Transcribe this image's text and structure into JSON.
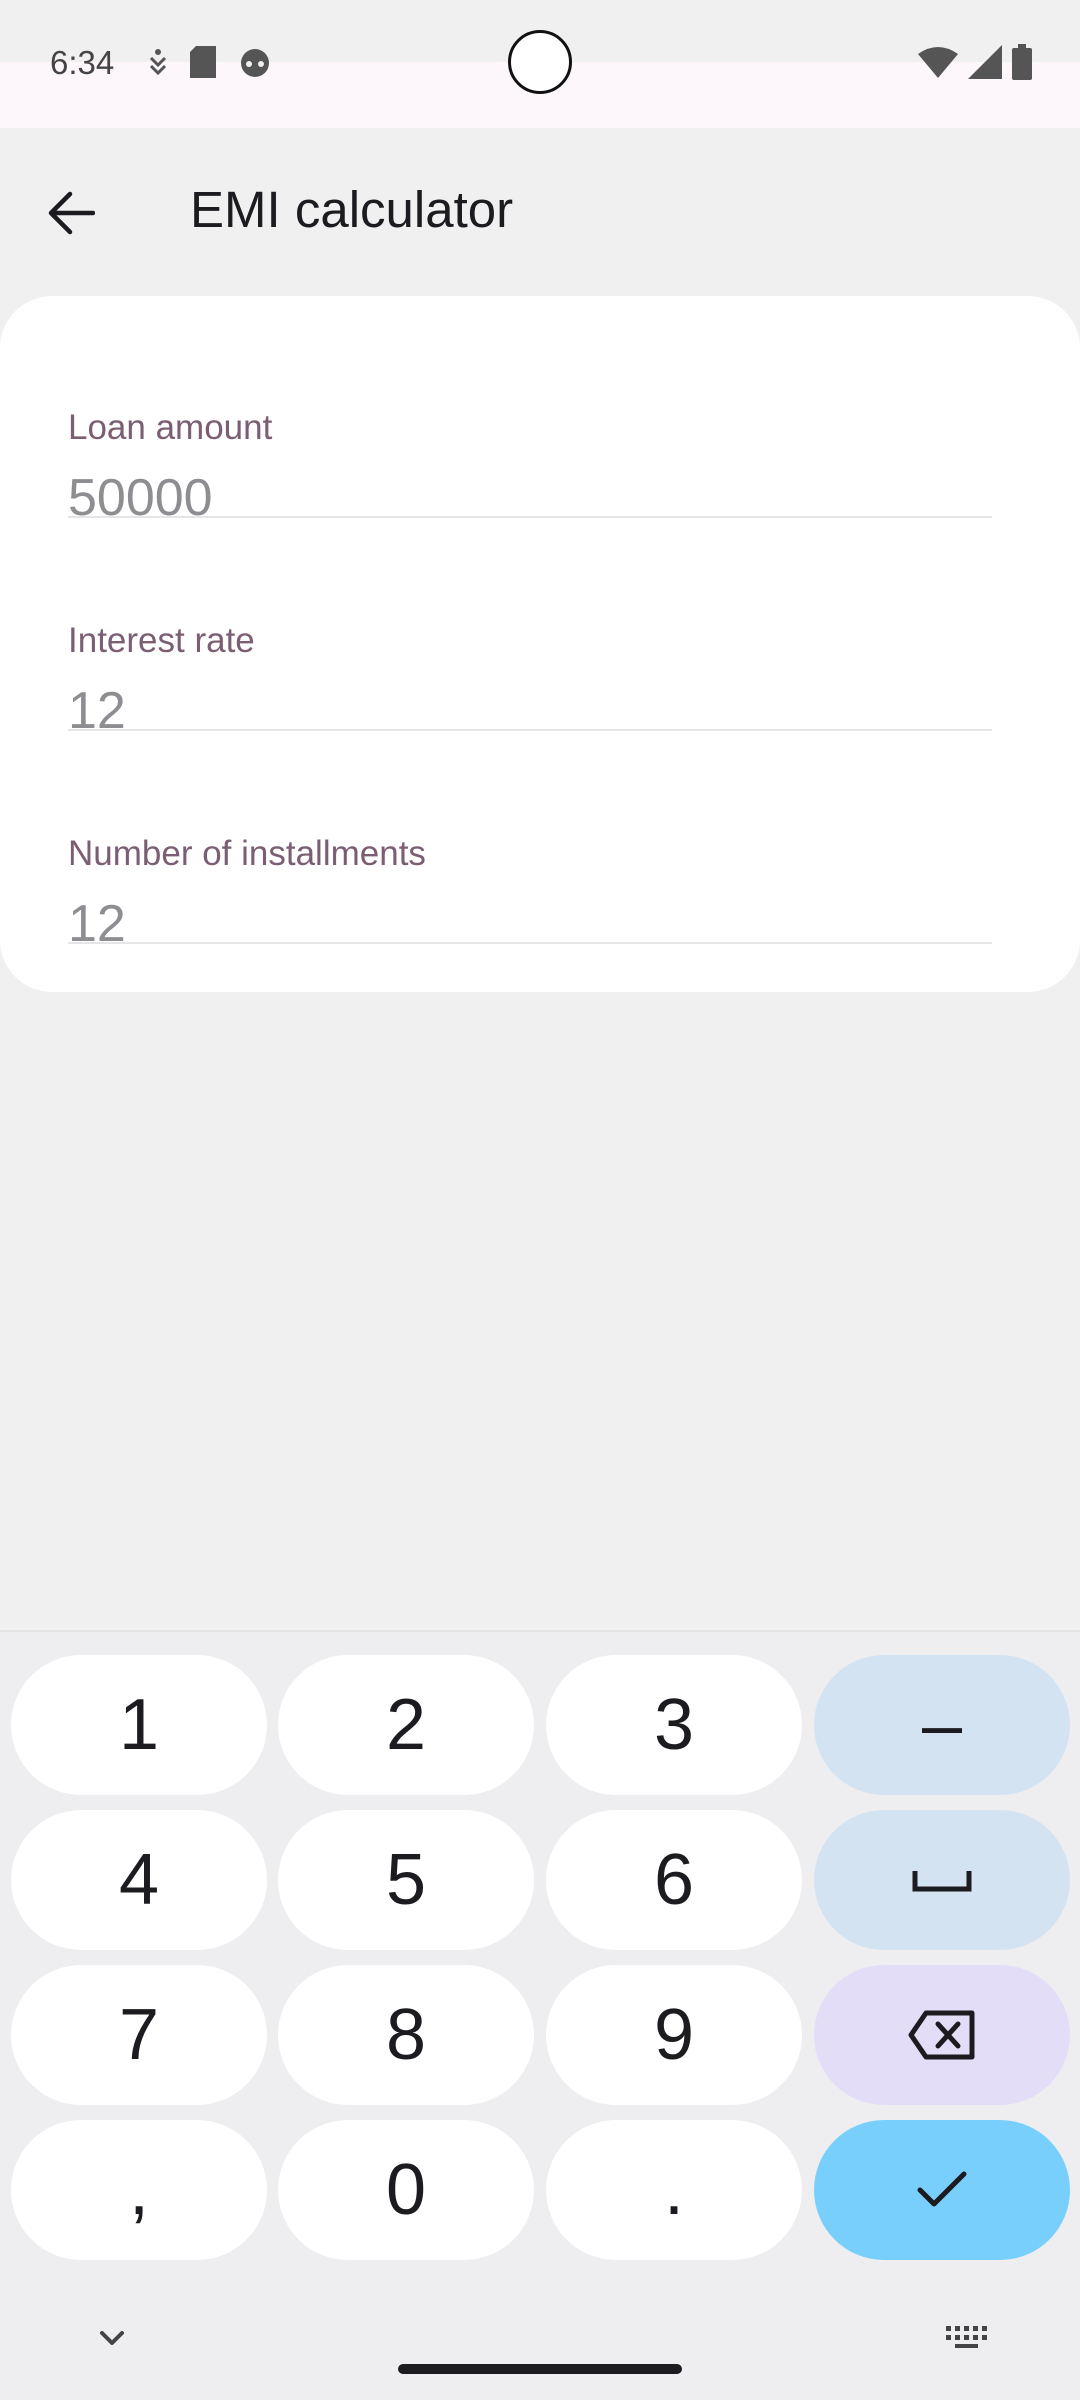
{
  "status_bar": {
    "time": "6:34"
  },
  "app_bar": {
    "title": "EMI calculator",
    "back_icon": "arrow-back-icon"
  },
  "form": {
    "fields": [
      {
        "label": "Loan amount",
        "value": "50000"
      },
      {
        "label": "Interest rate",
        "value": "12"
      },
      {
        "label": "Number of installments",
        "value": "12"
      }
    ]
  },
  "keyboard": {
    "rows": [
      [
        "1",
        "2",
        "3",
        "–"
      ],
      [
        "4",
        "5",
        "6",
        "space"
      ],
      [
        "7",
        "8",
        "9",
        "backspace"
      ],
      [
        ",",
        "0",
        ".",
        "done"
      ]
    ],
    "keys": {
      "k1": "1",
      "k2": "2",
      "k3": "3",
      "dash": "–",
      "k4": "4",
      "k5": "5",
      "k6": "6",
      "k7": "7",
      "k8": "8",
      "k9": "9",
      "comma": ",",
      "k0": "0",
      "period": "."
    }
  },
  "colors": {
    "accent_label": "#7b5e73",
    "key_side": "#d3e3f2",
    "key_delete": "#e3ddf8",
    "key_enter": "#79cffb"
  }
}
